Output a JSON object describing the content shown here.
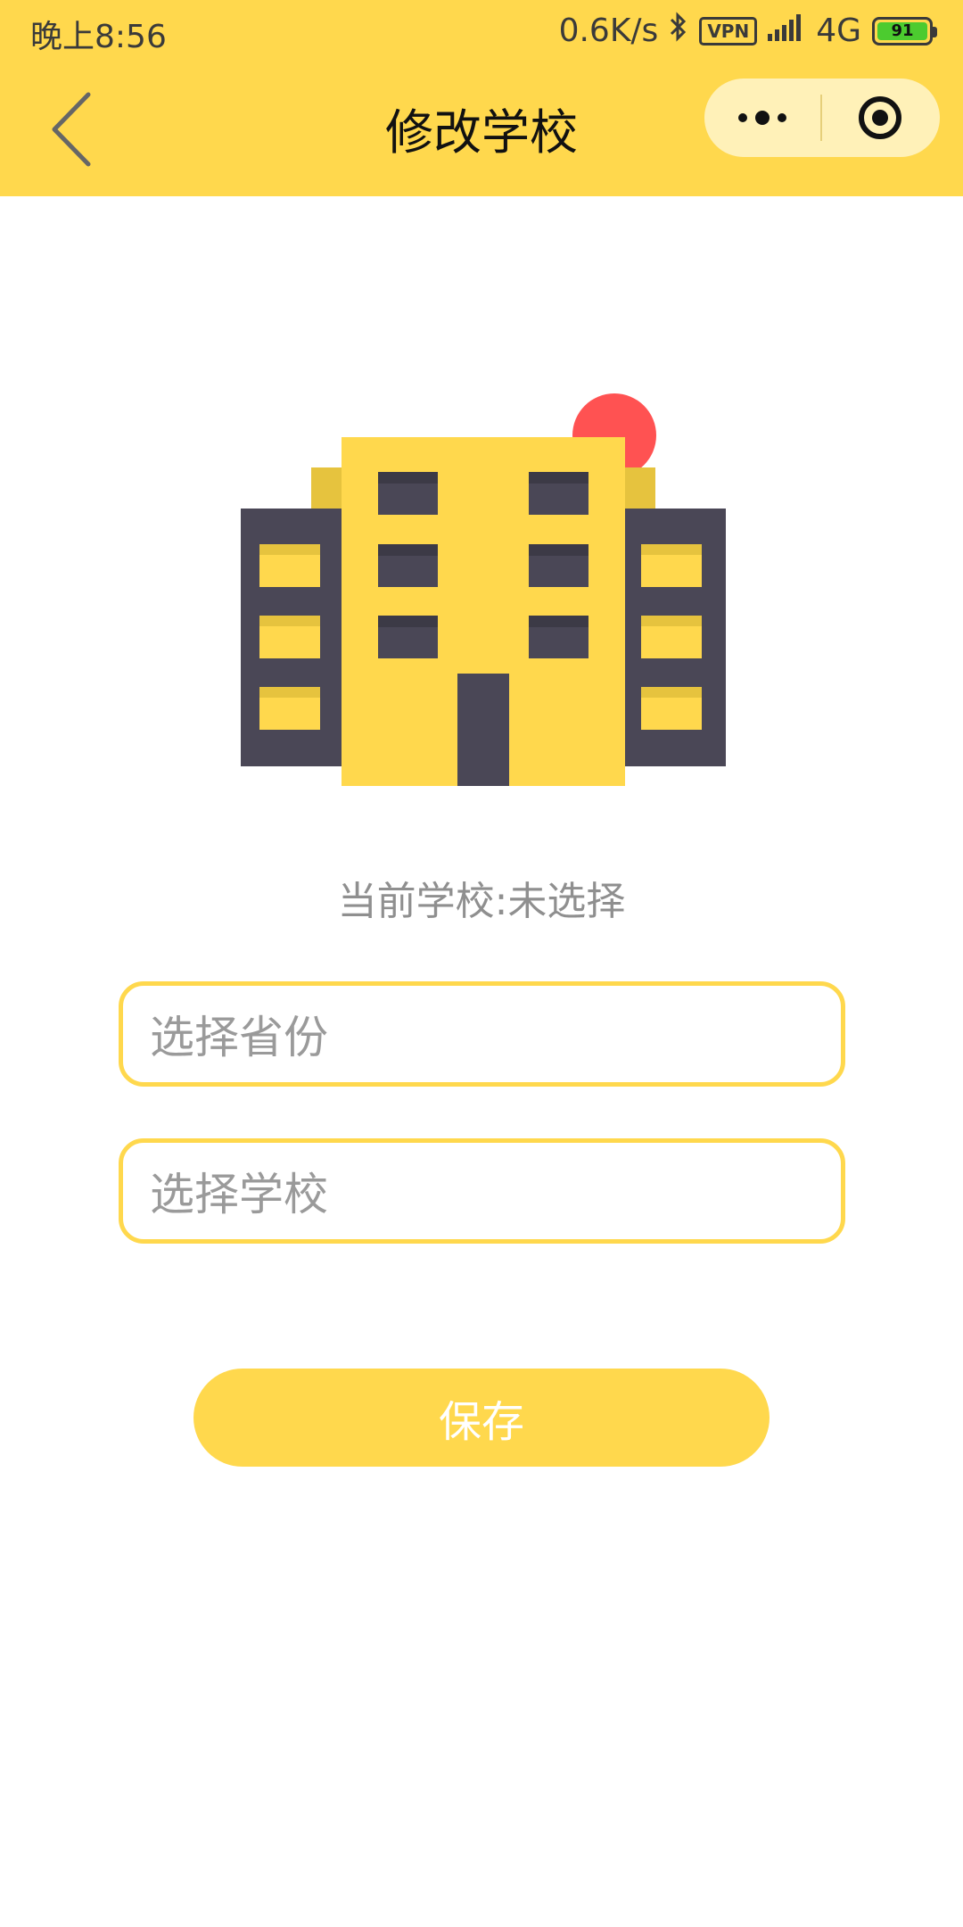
{
  "status_bar": {
    "time": "晚上8:56",
    "net_speed": "0.6K/s",
    "vpn": "VPN",
    "network": "4G",
    "battery": "91"
  },
  "nav": {
    "title": "修改学校"
  },
  "main": {
    "current_school": "当前学校:未选择",
    "province_placeholder": "选择省份",
    "school_placeholder": "选择学校",
    "save_label": "保存"
  },
  "colors": {
    "accent": "#FFD84D",
    "dark": "#4A4756",
    "dot": "#FF5252"
  }
}
